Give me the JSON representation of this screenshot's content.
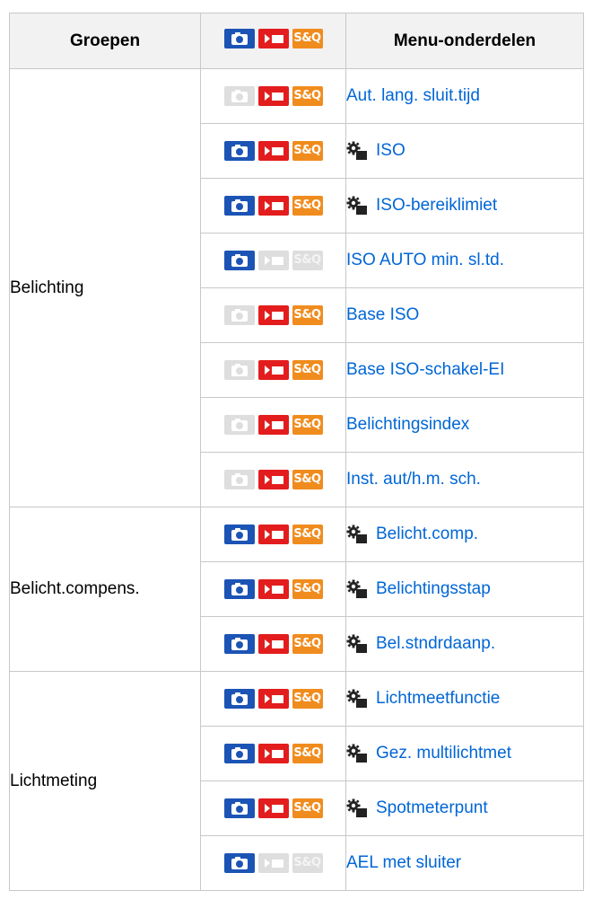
{
  "header": {
    "col_groups": "Groepen",
    "col_items": "Menu-onderdelen",
    "header_icons": [
      "photo",
      "movie",
      "sq"
    ]
  },
  "icons": {
    "sq_label": "S&Q"
  },
  "colors": {
    "photo": "#1c54b5",
    "movie": "#e31d1d",
    "sq": "#f08c1e",
    "disabled": "#dedede",
    "link": "#0066d6"
  },
  "groups": [
    {
      "label": "Belichting",
      "rows": [
        {
          "photo": false,
          "movie": true,
          "sq": true,
          "gear": false,
          "item": "Aut. lang. sluit.tijd"
        },
        {
          "photo": true,
          "movie": true,
          "sq": true,
          "gear": true,
          "item": "ISO"
        },
        {
          "photo": true,
          "movie": true,
          "sq": true,
          "gear": true,
          "item": "ISO-bereiklimiet"
        },
        {
          "photo": true,
          "movie": false,
          "sq": false,
          "gear": false,
          "item": "ISO AUTO min. sl.td."
        },
        {
          "photo": false,
          "movie": true,
          "sq": true,
          "gear": false,
          "item": "Base ISO"
        },
        {
          "photo": false,
          "movie": true,
          "sq": true,
          "gear": false,
          "item": "Base ISO-schakel-EI"
        },
        {
          "photo": false,
          "movie": true,
          "sq": true,
          "gear": false,
          "item": "Belichtingsindex"
        },
        {
          "photo": false,
          "movie": true,
          "sq": true,
          "gear": false,
          "item": "Inst. aut/h.m. sch."
        }
      ]
    },
    {
      "label": "Belicht.compens.",
      "rows": [
        {
          "photo": true,
          "movie": true,
          "sq": true,
          "gear": true,
          "item": "Belicht.comp."
        },
        {
          "photo": true,
          "movie": true,
          "sq": true,
          "gear": true,
          "item": "Belichtingsstap"
        },
        {
          "photo": true,
          "movie": true,
          "sq": true,
          "gear": true,
          "item": "Bel.stndrdaanp."
        }
      ]
    },
    {
      "label": "Lichtmeting",
      "rows": [
        {
          "photo": true,
          "movie": true,
          "sq": true,
          "gear": true,
          "item": "Lichtmeetfunctie"
        },
        {
          "photo": true,
          "movie": true,
          "sq": true,
          "gear": true,
          "item": "Gez. multilichtmet"
        },
        {
          "photo": true,
          "movie": true,
          "sq": true,
          "gear": true,
          "item": "Spotmeterpunt"
        },
        {
          "photo": true,
          "movie": false,
          "sq": false,
          "gear": false,
          "item": "AEL met sluiter"
        }
      ]
    }
  ]
}
